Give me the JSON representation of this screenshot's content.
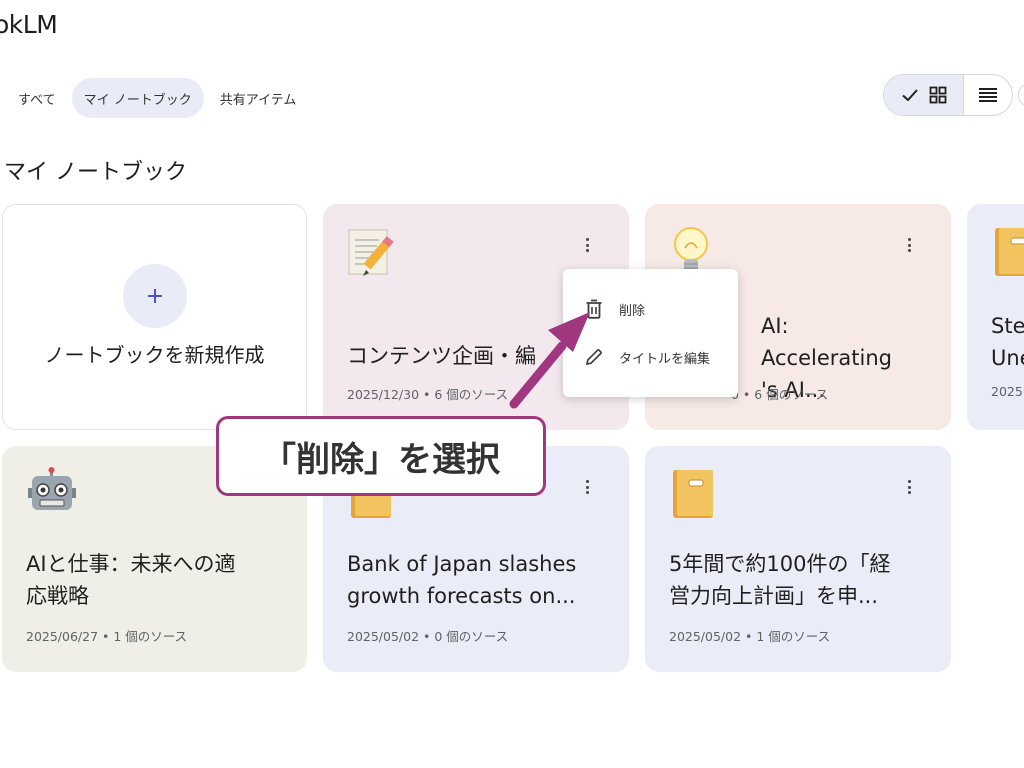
{
  "app": {
    "title": "okLM"
  },
  "filters": [
    {
      "label": "すべて"
    },
    {
      "label": "マイ ノートブック"
    },
    {
      "label": "共有アイテム"
    }
  ],
  "section": {
    "title": "マイ ノートブック"
  },
  "new_notebook": {
    "label": "ノートブックを新規作成"
  },
  "notebooks": [
    {
      "title": "コンテンツ企画・編",
      "meta": "2025/12/30 • 6 個のソース",
      "icon": "memo-icon"
    },
    {
      "title": "AI: Accelerating\n's AI...",
      "meta": "0 • 6 個のソース",
      "icon": "lightbulb-icon"
    },
    {
      "title": "Ste\nUne",
      "meta": "2025",
      "icon": "notebook-icon"
    },
    {
      "title": "AIと仕事：未来への適\n応戦略",
      "meta": "2025/06/27 • 1 個のソース",
      "icon": "robot-icon"
    },
    {
      "title": "Bank of Japan slashes\ngrowth forecasts on...",
      "meta": "2025/05/02 • 0 個のソース",
      "icon": "notebook-icon"
    },
    {
      "title": "5年間で約100件の「経\n営力向上計画」を申...",
      "meta": "2025/05/02 • 1 個のソース",
      "icon": "notebook-icon"
    }
  ],
  "context_menu": {
    "delete_label": "削除",
    "rename_label": "タイトルを編集"
  },
  "annotation": {
    "text": "「削除」を選択"
  },
  "colors": {
    "accent": "#a0377f",
    "chip_active": "#e9ecf7"
  }
}
